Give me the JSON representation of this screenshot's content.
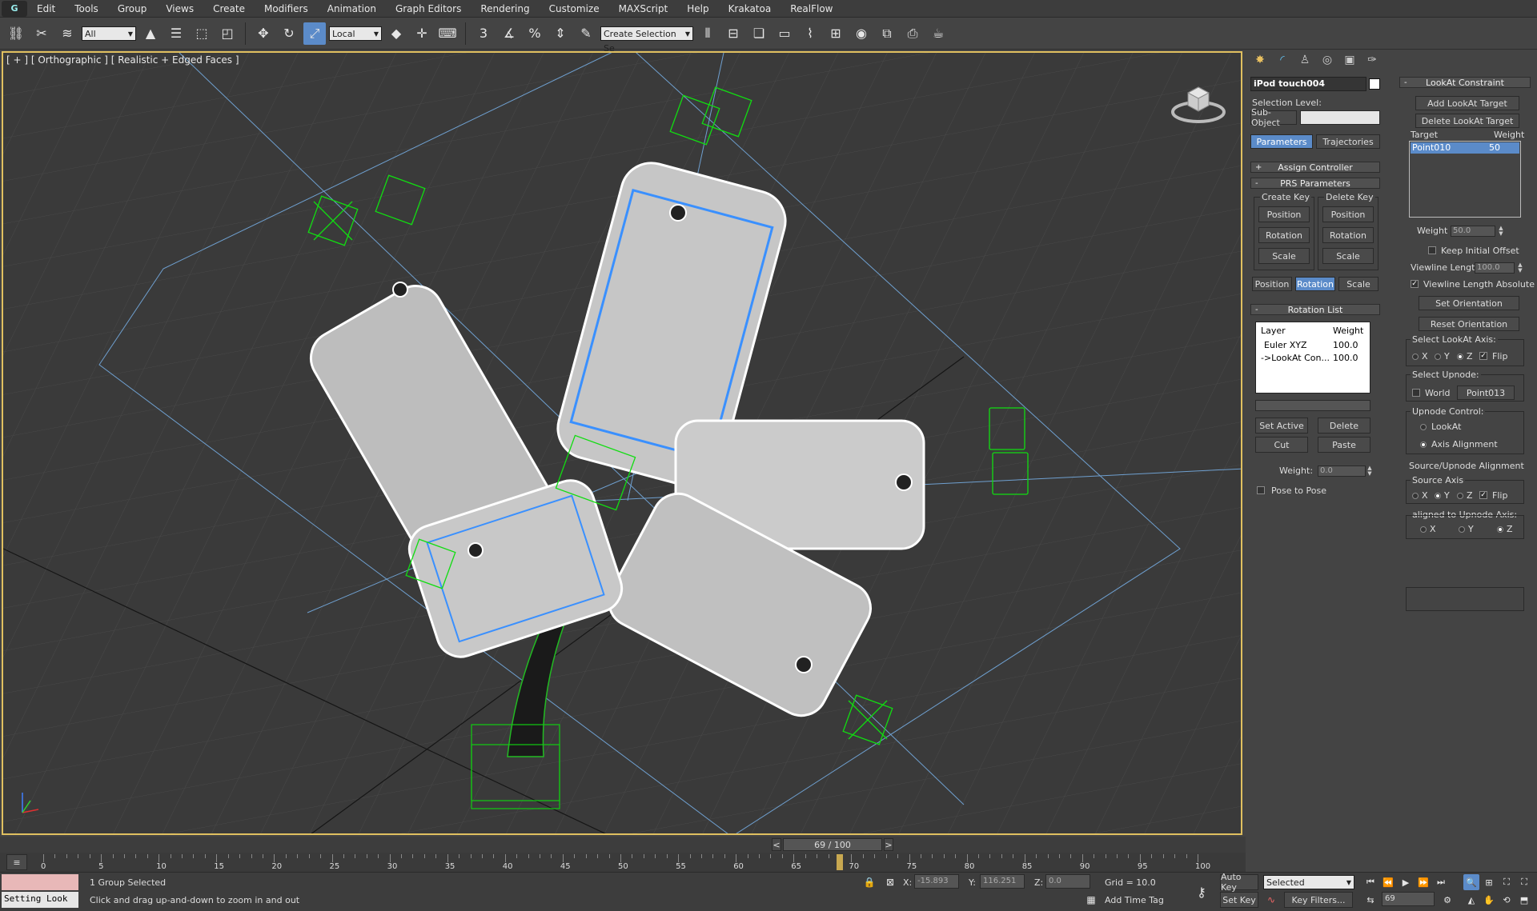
{
  "menu": [
    "Edit",
    "Tools",
    "Group",
    "Views",
    "Create",
    "Modifiers",
    "Animation",
    "Graph Editors",
    "Rendering",
    "Customize",
    "MAXScript",
    "Help",
    "Krakatoa",
    "RealFlow"
  ],
  "toolbar": {
    "filter_value": "All",
    "ref_coord": "Local",
    "selection_set_placeholder": "Create Selection Se"
  },
  "viewport": {
    "label": "[ + ] [ Orthographic ] [ Realistic + Edged Faces ]"
  },
  "command_panel": {
    "object_name": "iPod touch004",
    "selection_level_label": "Selection Level:",
    "sub_object_label": "Sub-Object",
    "tabs": [
      "Parameters",
      "Trajectories"
    ],
    "assign_controller": "Assign Controller",
    "prs_parameters": "PRS Parameters",
    "create_key": "Create Key",
    "delete_key": "Delete Key",
    "create_buttons": [
      "Position",
      "Rotation",
      "Scale"
    ],
    "delete_buttons": [
      "Position",
      "Rotation",
      "Scale"
    ],
    "mode_buttons": [
      "Position",
      "Rotation",
      "Scale"
    ],
    "rotation_list": {
      "title": "Rotation List",
      "col_layer": "Layer",
      "col_weight": "Weight",
      "rows": [
        {
          "layer": "Euler XYZ",
          "weight": "100.0"
        },
        {
          "layer": "->LookAt Con...",
          "weight": "100.0"
        }
      ],
      "set_active": "Set Active",
      "delete": "Delete",
      "cut": "Cut",
      "paste": "Paste",
      "weight_label": "Weight:",
      "weight_value": "0.0",
      "pose_to_pose": "Pose to Pose"
    }
  },
  "lookat": {
    "title": "LookAt Constraint",
    "add_target": "Add LookAt Target",
    "delete_target": "Delete LookAt Target",
    "col_target": "Target",
    "col_weight": "Weight",
    "targets": [
      {
        "name": "Point010",
        "weight": "50"
      }
    ],
    "weight_label": "Weight",
    "weight_value": "50.0",
    "keep_initial_offset": "Keep Initial Offset",
    "viewline_length_label": "Viewline Length",
    "viewline_length_value": "100.0",
    "viewline_absolute": "Viewline Length Absolute",
    "set_orientation": "Set Orientation",
    "reset_orientation": "Reset Orientation",
    "select_axis_label": "Select LookAt Axis:",
    "axes": [
      "X",
      "Y",
      "Z"
    ],
    "flip": "Flip",
    "select_upnode_label": "Select Upnode:",
    "world": "World",
    "upnode_value": "Point013",
    "upnode_control_label": "Upnode Control:",
    "upnode_lookat": "LookAt",
    "upnode_axis_alignment": "Axis Alignment",
    "source_upnode_label": "Source/Upnode Alignment",
    "source_axis_label": "Source Axis",
    "aligned_label": "aligned to Upnode Axis:"
  },
  "timeline": {
    "frame_display": "69 / 100",
    "current_frame": 69,
    "total_frames": 100,
    "ticks": [
      "0",
      "5",
      "10",
      "15",
      "20",
      "25",
      "30",
      "35",
      "40",
      "45",
      "50",
      "55",
      "60",
      "65",
      "70",
      "75",
      "80",
      "85",
      "90",
      "95",
      "100"
    ]
  },
  "status": {
    "maxscript_text": "Setting Look",
    "selection_info": "1 Group Selected",
    "prompt": "Click and drag up-and-down to zoom in and out",
    "x_label": "X:",
    "x_value": "-15.893",
    "y_label": "Y:",
    "y_value": "116.251",
    "z_label": "Z:",
    "z_value": "0.0",
    "grid": "Grid = 10.0",
    "add_time_tag": "Add Time Tag",
    "auto_key": "Auto Key",
    "set_key": "Set Key",
    "selected_value": "Selected",
    "key_filters": "Key Filters...",
    "frame_value": "69"
  }
}
